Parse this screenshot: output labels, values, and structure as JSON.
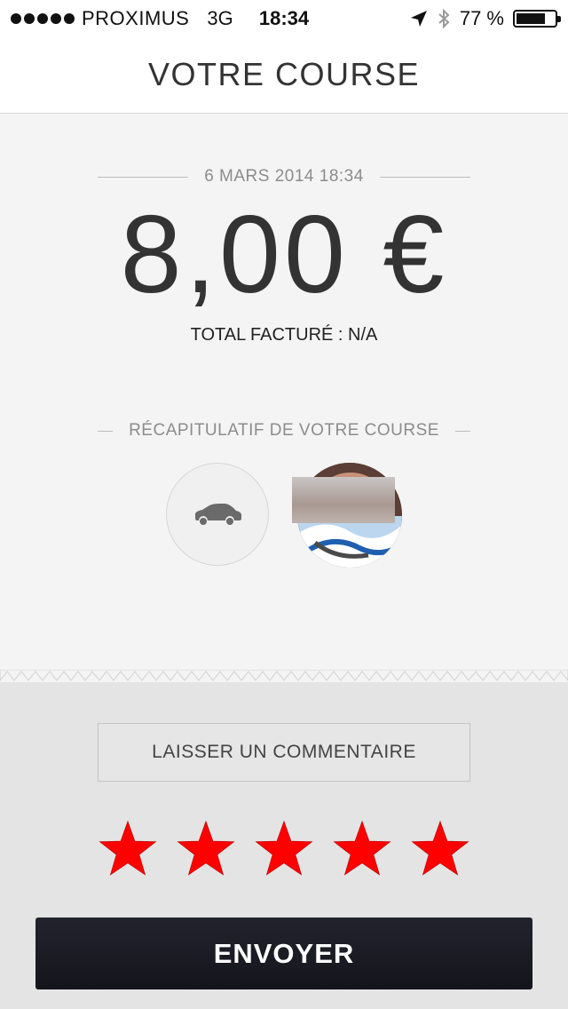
{
  "status_bar": {
    "carrier": "PROXIMUS",
    "network": "3G",
    "time": "18:34",
    "battery": "77 %",
    "battery_level": 0.77
  },
  "header": {
    "title": "VOTRE COURSE"
  },
  "receipt": {
    "date": "6 MARS 2014 18:34",
    "amount": "8,00 €",
    "total_label": "TOTAL FACTURÉ : N/A",
    "summary_label": "RÉCAPITULATIF DE VOTRE COURSE"
  },
  "feedback": {
    "comment_label": "LAISSER UN COMMENTAIRE",
    "rating": 5,
    "rating_max": 5,
    "star_color": "#ff0000"
  },
  "send_label": "ENVOYER",
  "colors": {
    "send_bg": "#1b1c24",
    "receipt_bg": "#f4f4f4",
    "page_bg": "#e4e4e4"
  }
}
